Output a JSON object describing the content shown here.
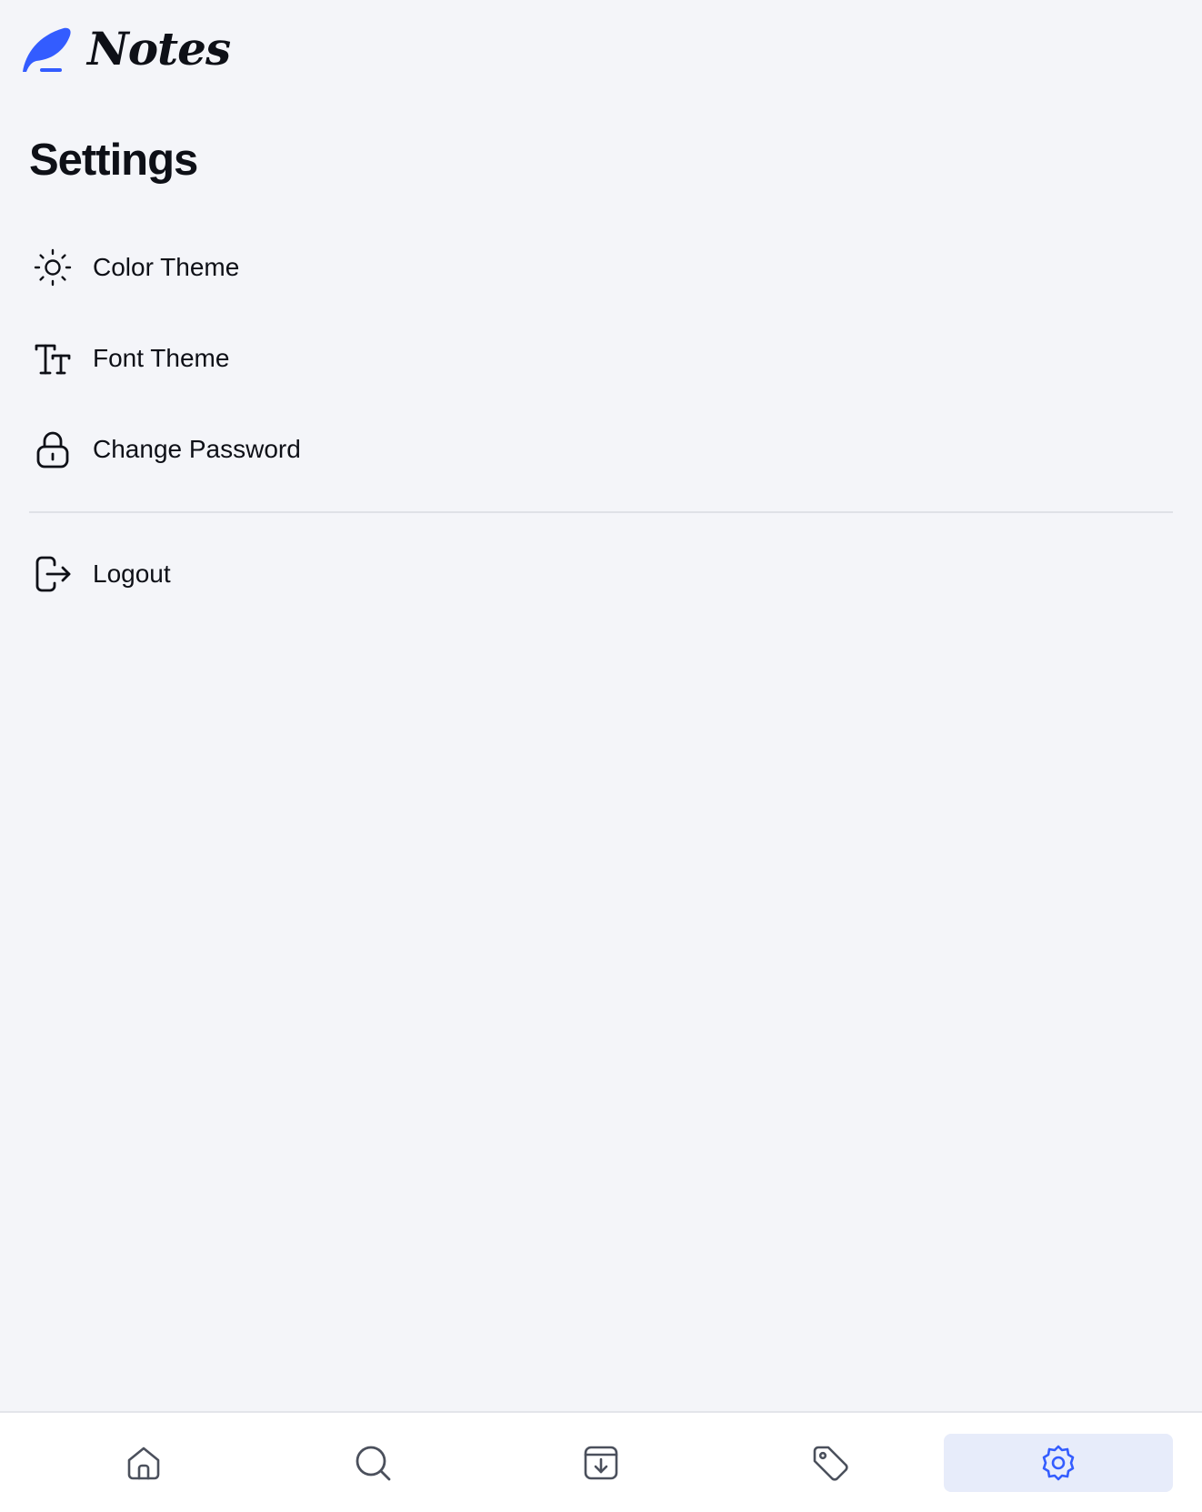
{
  "app": {
    "name": "Notes",
    "accent_color": "#335cff"
  },
  "page": {
    "title": "Settings"
  },
  "settings": {
    "items": [
      {
        "label": "Color Theme",
        "icon": "sun-icon"
      },
      {
        "label": "Font Theme",
        "icon": "text-size-icon"
      },
      {
        "label": "Change Password",
        "icon": "lock-icon"
      }
    ],
    "logout": {
      "label": "Logout",
      "icon": "logout-icon"
    }
  },
  "bottom_nav": {
    "items": [
      {
        "name": "Home",
        "icon": "home-icon",
        "active": false
      },
      {
        "name": "Search",
        "icon": "search-icon",
        "active": false
      },
      {
        "name": "Archive",
        "icon": "archive-icon",
        "active": false
      },
      {
        "name": "Tags",
        "icon": "tag-icon",
        "active": false
      },
      {
        "name": "Settings",
        "icon": "settings-icon",
        "active": true
      }
    ]
  }
}
